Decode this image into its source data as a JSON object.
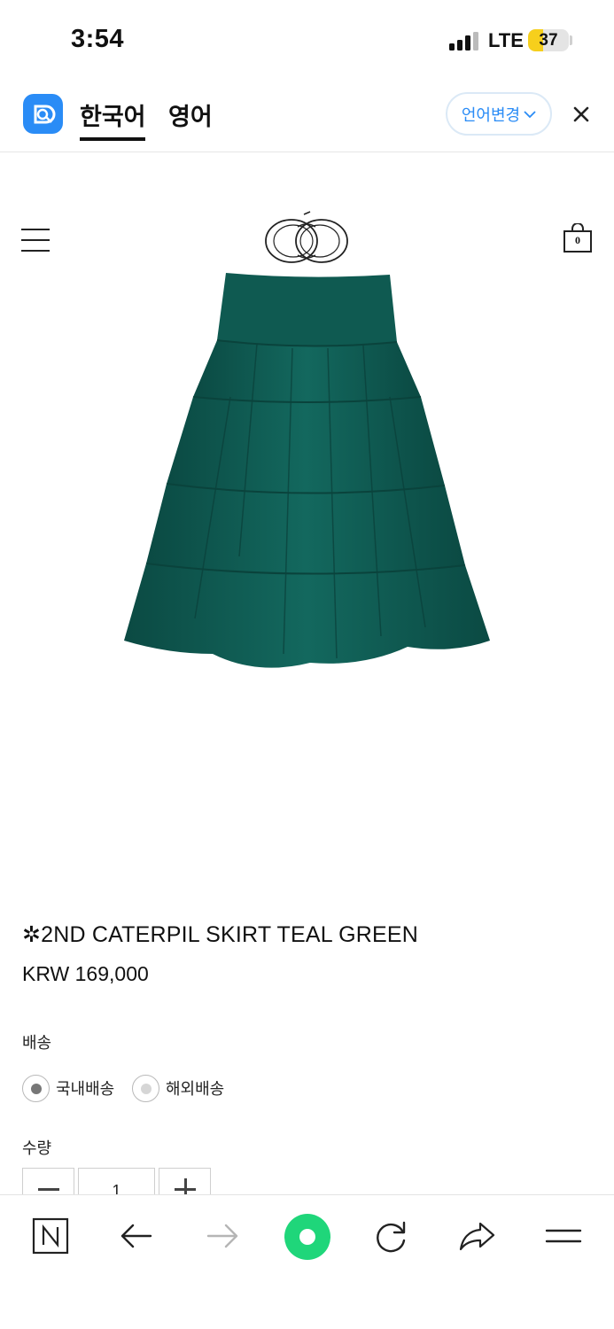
{
  "status_bar": {
    "time": "3:54",
    "network": "LTE",
    "battery": "37",
    "battery_level": 0.37
  },
  "translate_bar": {
    "tabs": [
      {
        "label": "한국어",
        "active": true
      },
      {
        "label": "영어",
        "active": false
      }
    ],
    "change_language": "언어변경",
    "icons": {
      "app": "translate-app-icon",
      "close": "close-icon",
      "dropdown": "chevron-down-icon"
    }
  },
  "shop_header": {
    "cart_count": "0",
    "icons": {
      "menu": "hamburger-menu-icon",
      "logo": "brand-logo",
      "cart": "shopping-bag-icon"
    }
  },
  "product": {
    "name": "✲2ND CATERPIL SKIRT TEAL GREEN",
    "price": "KRW 169,000",
    "image_color": "#0e5a52"
  },
  "options": {
    "shipping_label": "배송",
    "shipping_options": [
      {
        "label": "국내배송",
        "selected": true
      },
      {
        "label": "해외배송",
        "selected": false
      }
    ],
    "quantity_label": "수량",
    "quantity": "1"
  },
  "bottom_bar": {
    "buttons": [
      "naver-home-icon",
      "back-arrow-icon",
      "forward-arrow-icon",
      "green-assistant-icon",
      "reload-icon",
      "share-icon",
      "menu-icon"
    ]
  },
  "colors": {
    "accent_blue": "#2a8cf6",
    "battery_yellow": "#f6cf1c",
    "assistant_green": "#1fd67a"
  }
}
